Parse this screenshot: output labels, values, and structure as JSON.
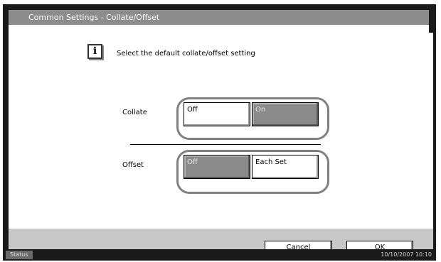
{
  "title_bar": {
    "title": "Common Settings - Collate/Offset"
  },
  "info": {
    "message": "Select the default collate/offset setting"
  },
  "collate": {
    "label": "Collate",
    "options": [
      {
        "label": "Off",
        "selected": false
      },
      {
        "label": "On",
        "selected": true
      }
    ]
  },
  "offset": {
    "label": "Offset",
    "options": [
      {
        "label": "Off",
        "selected": true
      },
      {
        "label": "Each Set",
        "selected": false
      }
    ]
  },
  "footer": {
    "cancel_label": "Cancel",
    "ok_label": "OK"
  },
  "status_bar": {
    "status_label": "Status",
    "datetime": "10/10/2007  10:10"
  },
  "colors": {
    "selected_button": "#8a8a8a",
    "ring": "#808080",
    "title_bar": "#8c8c8c",
    "footer": "#c8c8c8"
  },
  "icons": {
    "info": "info-icon"
  }
}
